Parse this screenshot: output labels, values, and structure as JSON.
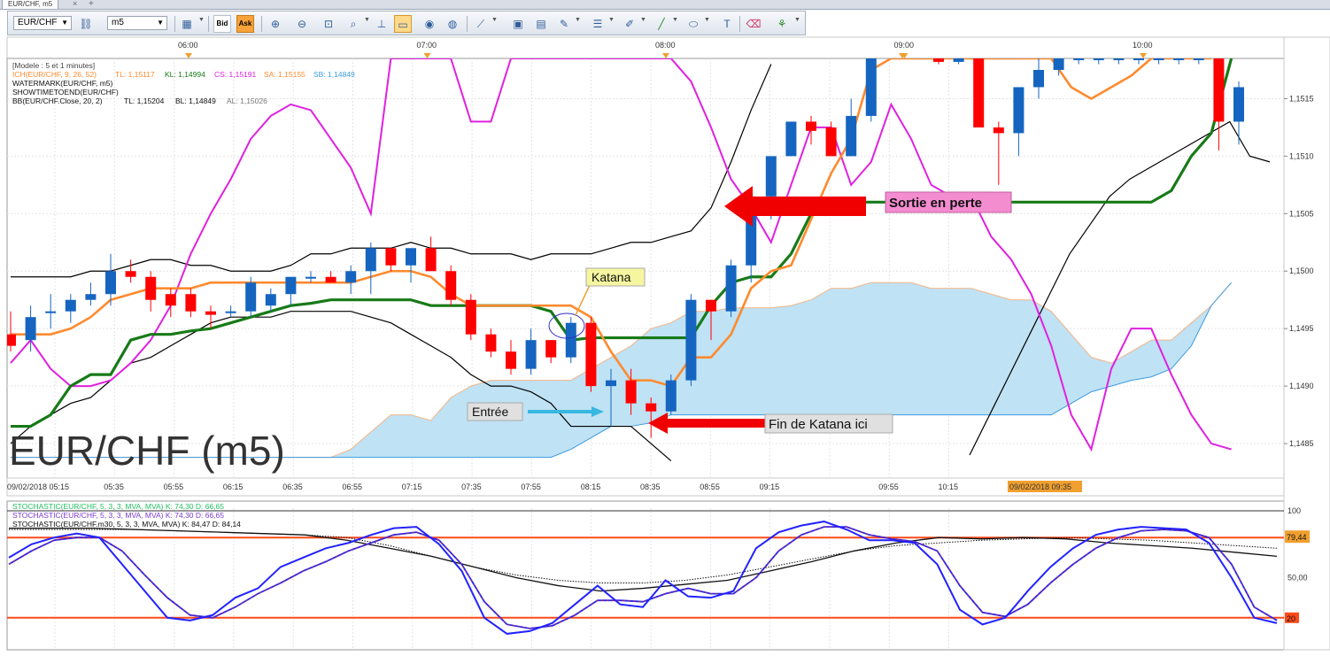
{
  "window": {
    "tab_title": "EUR/CHF, m5",
    "tab_close": "×",
    "tab_add": "+"
  },
  "toolbar": {
    "symbol": "EUR/CHF",
    "period": "m5",
    "bid_label": "Bid",
    "ask_label": "Ask",
    "icons": [
      "link-icon",
      "line-chart-icon",
      "zoom-in-icon",
      "zoom-out-icon",
      "zoom-fit-icon",
      "crosshair-icon",
      "select-icon",
      "eye-icon",
      "globe-icon",
      "ruler-icon",
      "image-icon",
      "save-image-icon",
      "tools-icon",
      "lines-icon",
      "pen-icon",
      "line-icon",
      "ellipse-icon",
      "text-icon",
      "eraser-icon",
      "tree-icon"
    ]
  },
  "colors": {
    "bull": "#1565c0",
    "bear": "#ff0000",
    "tenkan": "#ff8a2e",
    "kijun": "#177a17",
    "bb": "#000000",
    "chikou": "#e020e0",
    "cloud": "#bfe2f4",
    "cloud_edge": "#3d9be0",
    "stoch_k": "#2222ff",
    "stoch_d": "#c03030",
    "level": "#ff4a1a",
    "marker": "#f0a030"
  },
  "chart_data": [
    {
      "type": "candlestick",
      "title": "EUR/CHF (m5)",
      "legend": {
        "line1": "[Modele : 5 et 1 minutes]",
        "ich": {
          "name": "ICH(EUR/CHF, 9, 26, 52)",
          "tl": "TL: 1,15117",
          "kl": "KL: 1,14994",
          "cs": "CS: 1,15191",
          "sa": "SA: 1,15155",
          "sb": "SB: 1,14849"
        },
        "line3": "WATERMARK(EUR/CHF, m5)",
        "line4": "SHOWTIMETOEND(EUR/CHF)",
        "bb": {
          "name": "BB(EUR/CHF.Close, 20, 2)",
          "tl": "TL: 1,15204",
          "bl": "BL: 1,14849",
          "al": "AL: 1,15026"
        }
      },
      "top_time_labels": [
        "06:00",
        "07:00",
        "08:00",
        "09:00",
        "10:00"
      ],
      "bottom_time_labels": [
        "09/02/2018 05:15",
        "05:35",
        "05:55",
        "06:15",
        "06:35",
        "06:55",
        "07:15",
        "07:35",
        "07:55",
        "08:15",
        "08:35",
        "08:55",
        "09:15",
        "09/02/2018 09:35",
        "09:55",
        "10:15"
      ],
      "y_ticks": [
        "1,1515",
        "1,1510",
        "1,1505",
        "1,1500",
        "1,1495",
        "1,1490",
        "1,1485"
      ],
      "ylim": [
        1.1482,
        1.15185
      ],
      "candles": [
        {
          "o": 1.14945,
          "h": 1.14965,
          "l": 1.1493,
          "c": 1.14935
        },
        {
          "o": 1.1494,
          "h": 1.1497,
          "l": 1.1493,
          "c": 1.1496
        },
        {
          "o": 1.14965,
          "h": 1.1498,
          "l": 1.1495,
          "c": 1.14965
        },
        {
          "o": 1.14965,
          "h": 1.1498,
          "l": 1.14955,
          "c": 1.14975
        },
        {
          "o": 1.14975,
          "h": 1.1499,
          "l": 1.1497,
          "c": 1.1498
        },
        {
          "o": 1.1498,
          "h": 1.15015,
          "l": 1.1497,
          "c": 1.15
        },
        {
          "o": 1.15,
          "h": 1.1501,
          "l": 1.1499,
          "c": 1.14995
        },
        {
          "o": 1.14995,
          "h": 1.15,
          "l": 1.14965,
          "c": 1.14975
        },
        {
          "o": 1.1498,
          "h": 1.14985,
          "l": 1.1496,
          "c": 1.1497
        },
        {
          "o": 1.1498,
          "h": 1.14985,
          "l": 1.1496,
          "c": 1.14965
        },
        {
          "o": 1.14965,
          "h": 1.1497,
          "l": 1.1495,
          "c": 1.14962
        },
        {
          "o": 1.14965,
          "h": 1.1497,
          "l": 1.1496,
          "c": 1.14965
        },
        {
          "o": 1.14965,
          "h": 1.14995,
          "l": 1.1496,
          "c": 1.1499
        },
        {
          "o": 1.1497,
          "h": 1.14985,
          "l": 1.14965,
          "c": 1.1498
        },
        {
          "o": 1.1498,
          "h": 1.14995,
          "l": 1.1497,
          "c": 1.14995
        },
        {
          "o": 1.14995,
          "h": 1.15,
          "l": 1.1499,
          "c": 1.14995
        },
        {
          "o": 1.14995,
          "h": 1.15,
          "l": 1.1499,
          "c": 1.1499
        },
        {
          "o": 1.1499,
          "h": 1.15005,
          "l": 1.1498,
          "c": 1.15
        },
        {
          "o": 1.15,
          "h": 1.15025,
          "l": 1.1498,
          "c": 1.1502
        },
        {
          "o": 1.1502,
          "h": 1.1502,
          "l": 1.15,
          "c": 1.15005
        },
        {
          "o": 1.15005,
          "h": 1.1502,
          "l": 1.1499,
          "c": 1.1502
        },
        {
          "o": 1.1502,
          "h": 1.1503,
          "l": 1.15,
          "c": 1.15
        },
        {
          "o": 1.15,
          "h": 1.15005,
          "l": 1.1497,
          "c": 1.14975
        },
        {
          "o": 1.14975,
          "h": 1.1498,
          "l": 1.1494,
          "c": 1.14945
        },
        {
          "o": 1.14945,
          "h": 1.1495,
          "l": 1.14925,
          "c": 1.1493
        },
        {
          "o": 1.1493,
          "h": 1.1494,
          "l": 1.1491,
          "c": 1.14915
        },
        {
          "o": 1.14915,
          "h": 1.1495,
          "l": 1.1491,
          "c": 1.1494
        },
        {
          "o": 1.1494,
          "h": 1.1494,
          "l": 1.1492,
          "c": 1.14925
        },
        {
          "o": 1.14925,
          "h": 1.1496,
          "l": 1.1492,
          "c": 1.14955
        },
        {
          "o": 1.14955,
          "h": 1.1496,
          "l": 1.14895,
          "c": 1.149
        },
        {
          "o": 1.149,
          "h": 1.14915,
          "l": 1.14865,
          "c": 1.14905
        },
        {
          "o": 1.14905,
          "h": 1.14915,
          "l": 1.14875,
          "c": 1.14885
        },
        {
          "o": 1.14885,
          "h": 1.1489,
          "l": 1.14855,
          "c": 1.14878
        },
        {
          "o": 1.14878,
          "h": 1.1491,
          "l": 1.14875,
          "c": 1.14905
        },
        {
          "o": 1.14905,
          "h": 1.1498,
          "l": 1.149,
          "c": 1.14975
        },
        {
          "o": 1.14975,
          "h": 1.14975,
          "l": 1.1494,
          "c": 1.14965
        },
        {
          "o": 1.14965,
          "h": 1.1501,
          "l": 1.1496,
          "c": 1.15005
        },
        {
          "o": 1.15005,
          "h": 1.15025,
          "l": 1.1499,
          "c": 1.15065
        },
        {
          "o": 1.15065,
          "h": 1.1509,
          "l": 1.15045,
          "c": 1.151
        },
        {
          "o": 1.151,
          "h": 1.1513,
          "l": 1.151,
          "c": 1.1513
        },
        {
          "o": 1.1513,
          "h": 1.15135,
          "l": 1.1511,
          "c": 1.15122
        },
        {
          "o": 1.15125,
          "h": 1.1513,
          "l": 1.151,
          "c": 1.151
        },
        {
          "o": 1.151,
          "h": 1.1515,
          "l": 1.151,
          "c": 1.15135
        },
        {
          "o": 1.15135,
          "h": 1.15185,
          "l": 1.1513,
          "c": 1.15185
        }
      ],
      "candles_tail_start_x": 1060,
      "candles_tail": [
        {
          "o": 1.15185,
          "h": 1.15185,
          "l": 1.1518,
          "c": 1.15182
        },
        {
          "o": 1.15182,
          "h": 1.15185,
          "l": 1.1518,
          "c": 1.15185
        },
        {
          "o": 1.15185,
          "h": 1.15185,
          "l": 1.15125,
          "c": 1.15125
        },
        {
          "o": 1.15125,
          "h": 1.1513,
          "l": 1.15075,
          "c": 1.1512
        },
        {
          "o": 1.1512,
          "h": 1.1516,
          "l": 1.151,
          "c": 1.1516
        },
        {
          "o": 1.1516,
          "h": 1.15185,
          "l": 1.1515,
          "c": 1.15175
        },
        {
          "o": 1.15175,
          "h": 1.15185,
          "l": 1.1517,
          "c": 1.15185
        },
        {
          "o": 1.15185,
          "h": 1.15185,
          "l": 1.1518,
          "c": 1.15185
        },
        {
          "o": 1.15185,
          "h": 1.15185,
          "l": 1.1518,
          "c": 1.15185
        },
        {
          "o": 1.15185,
          "h": 1.15185,
          "l": 1.1518,
          "c": 1.15185
        },
        {
          "o": 1.15185,
          "h": 1.15185,
          "l": 1.1518,
          "c": 1.15185
        },
        {
          "o": 1.15185,
          "h": 1.15185,
          "l": 1.1518,
          "c": 1.15185
        },
        {
          "o": 1.15185,
          "h": 1.15185,
          "l": 1.1518,
          "c": 1.15185
        },
        {
          "o": 1.15185,
          "h": 1.15185,
          "l": 1.1518,
          "c": 1.15185
        },
        {
          "o": 1.15185,
          "h": 1.15185,
          "l": 1.15105,
          "c": 1.1513
        },
        {
          "o": 1.1513,
          "h": 1.15165,
          "l": 1.1511,
          "c": 1.1516
        }
      ],
      "tenkan": [
        1.14945,
        1.14945,
        1.14945,
        1.1495,
        1.1496,
        1.14975,
        1.1498,
        1.14985,
        1.14985,
        1.14985,
        1.1499,
        1.1499,
        1.1499,
        1.1499,
        1.1499,
        1.1499,
        1.1499,
        1.1499,
        1.14995,
        1.15,
        1.15,
        1.14995,
        1.1498,
        1.1497,
        1.1497,
        1.1497,
        1.1497,
        1.1497,
        1.1497,
        1.1496,
        1.1493,
        1.14905,
        1.14905,
        1.149,
        1.14925,
        1.14925,
        1.14945,
        1.14985,
        1.15,
        1.15005,
        1.15045,
        1.15085,
        1.15115,
        1.15175,
        1.15185
      ],
      "tenkan_tail": [
        1.15185,
        1.15185,
        1.15185,
        1.15185,
        1.15185,
        1.15185,
        1.15185,
        1.15185,
        1.1516,
        1.1515,
        1.1516,
        1.1517,
        1.15185,
        1.15185,
        1.15185,
        1.15185
      ],
      "kijun": [
        1.14865,
        1.14865,
        1.14875,
        1.149,
        1.1491,
        1.1491,
        1.1494,
        1.14945,
        1.14945,
        1.14948,
        1.1495,
        1.14955,
        1.1496,
        1.14965,
        1.1497,
        1.14972,
        1.14975,
        1.14975,
        1.14975,
        1.14975,
        1.14975,
        1.1497,
        1.1497,
        1.1497,
        1.1497,
        1.1497,
        1.1497,
        1.14965,
        1.1494,
        1.14942,
        1.14942,
        1.14942,
        1.14942,
        1.14942,
        1.14942,
        1.1497,
        1.1499,
        1.14995,
        1.14995,
        1.15015,
        1.1505,
        1.15055,
        1.1506,
        1.1506,
        1.1506,
        1.1506,
        1.1506,
        1.1506,
        1.1506,
        1.1506,
        1.1506,
        1.1506,
        1.1506,
        1.1506,
        1.1506,
        1.1506,
        1.1506,
        1.1506,
        1.1507,
        1.151,
        1.1512,
        1.15185
      ],
      "bb_upper": [
        1.14995,
        1.14995,
        1.14995,
        1.14995,
        1.15,
        1.15,
        1.15005,
        1.1501,
        1.1501,
        1.15005,
        1.15005,
        1.15,
        1.15,
        1.15,
        1.15005,
        1.15015,
        1.15015,
        1.1502,
        1.1502,
        1.1502,
        1.15025,
        1.1502,
        1.1502,
        1.15015,
        1.15015,
        1.15015,
        1.1501,
        1.15015,
        1.15015,
        1.15015,
        1.1502,
        1.15025,
        1.15025,
        1.1503,
        1.15035,
        1.15055,
        1.15095,
        1.1514,
        1.1518
      ],
      "bb_lower": [
        1.1485,
        1.14865,
        1.14875,
        1.14885,
        1.1489,
        1.14905,
        1.1492,
        1.14925,
        1.14935,
        1.14945,
        1.14955,
        1.1496,
        1.1496,
        1.1496,
        1.14965,
        1.14965,
        1.14965,
        1.14965,
        1.1496,
        1.14955,
        1.14945,
        1.14935,
        1.14925,
        1.1491,
        1.149,
        1.149,
        1.14895,
        1.14885,
        1.14865,
        1.14865,
        1.14865,
        1.14865,
        1.1485,
        1.14835
      ],
      "bb_tail_start_x": 1095,
      "bb_tail": [
        1.1484,
        1.14875,
        1.1491,
        1.14945,
        1.1498,
        1.15015,
        1.1504,
        1.15065,
        1.1508,
        1.1509,
        1.151,
        1.1511,
        1.1512,
        1.1513,
        1.151,
        1.15095
      ],
      "chikou": [
        1.1492,
        1.1494,
        1.14915,
        1.149,
        1.149,
        1.14905,
        1.1492,
        1.1494,
        1.1497,
        1.15015,
        1.1505,
        1.1508,
        1.15115,
        1.15135,
        1.15145,
        1.1514,
        1.15115,
        1.1509,
        1.1505,
        1.15185,
        1.15185,
        1.15185,
        1.15185,
        1.1513,
        1.1513,
        1.15185,
        1.15185,
        1.15185,
        1.15185,
        1.15185,
        1.15185,
        1.15185,
        1.15185,
        1.15185,
        1.15165,
        1.15125,
        1.1508,
        1.15055,
        1.15025,
        1.15075,
        1.15125,
        1.15125,
        1.15075,
        1.15095,
        1.15145,
        1.15115,
        1.15075,
        1.15065,
        1.15065,
        1.1503,
        1.1501,
        1.1498,
        1.14935,
        1.14875,
        1.14845,
        1.14915,
        1.1495,
        1.1495,
        1.1491,
        1.14875,
        1.1485,
        1.14845
      ],
      "cloud_top": [
        1.14838,
        1.14838,
        1.14838,
        1.14838,
        1.14838,
        1.14838,
        1.14838,
        1.14838,
        1.14838,
        1.14838,
        1.14838,
        1.14838,
        1.14838,
        1.14838,
        1.14838,
        1.14838,
        1.14838,
        1.14845,
        1.1486,
        1.14875,
        1.14875,
        1.1487,
        1.1489,
        1.149,
        1.14905,
        1.14905,
        1.14905,
        1.14905,
        1.14905,
        1.14915,
        1.14925,
        1.14935,
        1.1495,
        1.14955,
        1.14965,
        1.14965,
        1.14968,
        1.14968,
        1.14968,
        1.1497,
        1.14975,
        1.14985,
        1.14985,
        1.1499,
        1.1499,
        1.1499,
        1.14985,
        1.14985,
        1.14985,
        1.1498,
        1.14975,
        1.14975,
        1.14965,
        1.14945,
        1.14925,
        1.1492,
        1.1493,
        1.1494,
        1.1494,
        1.14955,
        1.1497,
        1.1499
      ],
      "cloud_bottom": [
        1.14838,
        1.14838,
        1.14838,
        1.14838,
        1.14838,
        1.14838,
        1.14838,
        1.14838,
        1.14838,
        1.14838,
        1.14838,
        1.14838,
        1.14838,
        1.14838,
        1.14838,
        1.14838,
        1.14838,
        1.14838,
        1.14838,
        1.14838,
        1.14838,
        1.14838,
        1.14838,
        1.14838,
        1.14838,
        1.14838,
        1.14838,
        1.14838,
        1.14845,
        1.14855,
        1.14865,
        1.14865,
        1.14868,
        1.14875,
        1.14875,
        1.14875,
        1.14875,
        1.14875,
        1.14875,
        1.14875,
        1.14875,
        1.14875,
        1.14875,
        1.14875,
        1.14875,
        1.14875,
        1.14875,
        1.14875,
        1.14875,
        1.14875,
        1.14875,
        1.14875,
        1.14875,
        1.14885,
        1.14895,
        1.149,
        1.14905,
        1.14908,
        1.14915,
        1.14935,
        1.1497,
        1.1499
      ],
      "annotations": {
        "katana": "Katana",
        "entree": "Entrée",
        "fin": "Fin de Katana ici",
        "sortie": "Sortie en perte"
      },
      "current_time_marker": "09/02/2018 09:35"
    },
    {
      "type": "line",
      "legend": [
        "STOCHASTIC(EUR/CHF, 5, 3, 3, MVA, MVA)  K: 74,30  D: 66,65",
        "STOCHASTIC(EUR/CHF, 5, 3, 3, MVA, MVA)  K: 74,30  D: 66,65",
        "STOCHASTIC(EUR/CHF.m30, 5, 3, 3, MVA, MVA)  K: 84,47  D: 84,14"
      ],
      "y_ticks": [
        "100",
        "50,00"
      ],
      "level_labels": [
        "79,44",
        "20"
      ],
      "ylim": [
        0,
        100
      ],
      "levels": [
        80,
        20
      ],
      "k": [
        65,
        75,
        80,
        83,
        80,
        60,
        40,
        20,
        18,
        22,
        35,
        42,
        58,
        65,
        72,
        76,
        82,
        87,
        88,
        75,
        55,
        20,
        8,
        10,
        16,
        30,
        44,
        30,
        28,
        48,
        36,
        35,
        40,
        72,
        84,
        89,
        92,
        86,
        78,
        78,
        76,
        60,
        26,
        15,
        20,
        40,
        58,
        72,
        82,
        86,
        88,
        87,
        86,
        76,
        50,
        20,
        16
      ],
      "d": [
        60,
        70,
        78,
        80,
        80,
        70,
        52,
        35,
        22,
        20,
        28,
        38,
        46,
        55,
        62,
        70,
        76,
        82,
        84,
        78,
        60,
        32,
        15,
        12,
        14,
        22,
        33,
        33,
        32,
        38,
        42,
        38,
        38,
        50,
        70,
        82,
        88,
        88,
        82,
        79,
        77,
        70,
        44,
        24,
        21,
        30,
        46,
        60,
        72,
        80,
        85,
        86,
        85,
        80,
        60,
        28,
        18
      ],
      "m30_k": [
        87,
        87,
        87,
        86,
        85,
        84,
        83,
        82,
        78,
        72,
        66,
        58,
        50,
        44,
        40,
        42,
        45,
        48,
        55,
        62,
        70,
        76,
        80,
        79,
        80,
        79,
        76,
        74,
        72,
        69,
        66
      ],
      "m30_d": [
        86,
        86,
        86,
        86,
        85,
        84,
        83,
        82,
        80,
        74,
        66,
        58,
        52,
        48,
        46,
        46,
        48,
        52,
        58,
        64,
        70,
        74,
        76,
        78,
        79,
        80,
        79,
        78,
        76,
        74,
        72
      ]
    }
  ]
}
